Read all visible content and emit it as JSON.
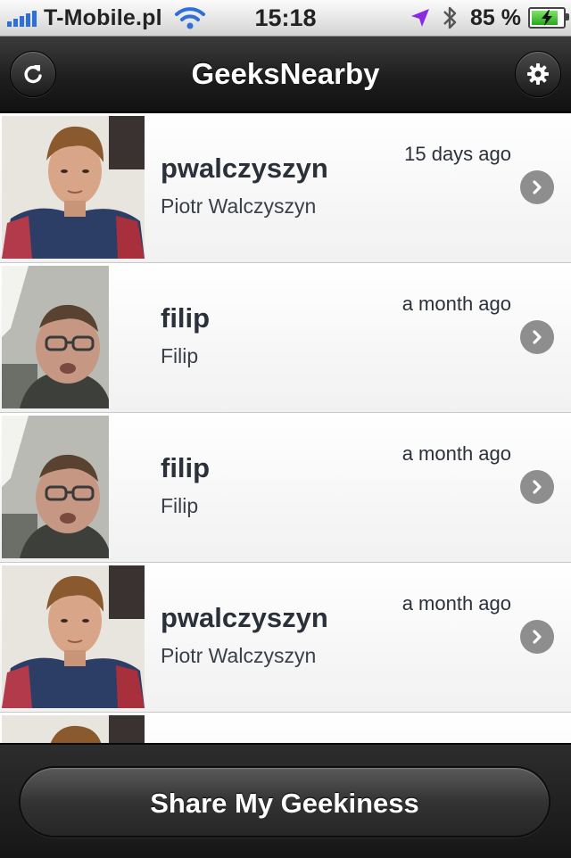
{
  "status_bar": {
    "carrier": "T-Mobile.pl",
    "time": "15:18",
    "battery_percent": "85 %",
    "battery_level": 0.85,
    "icons": [
      "signal-icon",
      "wifi-icon",
      "location-arrow-icon",
      "bluetooth-icon",
      "battery-charging-icon"
    ]
  },
  "nav": {
    "title": "GeeksNearby",
    "left_icon": "refresh-icon",
    "right_icon": "gear-icon"
  },
  "list": {
    "items": [
      {
        "username": "pwalczyszyn",
        "full_name": "Piotr Walczyszyn",
        "time_ago": "15 days ago"
      },
      {
        "username": "filip",
        "full_name": "Filip",
        "time_ago": "a month ago"
      },
      {
        "username": "filip",
        "full_name": "Filip",
        "time_ago": "a month ago"
      },
      {
        "username": "pwalczyszyn",
        "full_name": "Piotr Walczyszyn",
        "time_ago": "a month ago"
      }
    ]
  },
  "bottom": {
    "share_label": "Share My Geekiness"
  },
  "colors": {
    "nav_background": "#1e1e1e",
    "text_dark": "#2b313a",
    "chevron": "#8e8e8e",
    "signal_blue": "#2f6fd8",
    "battery_green": "#27a81a"
  }
}
